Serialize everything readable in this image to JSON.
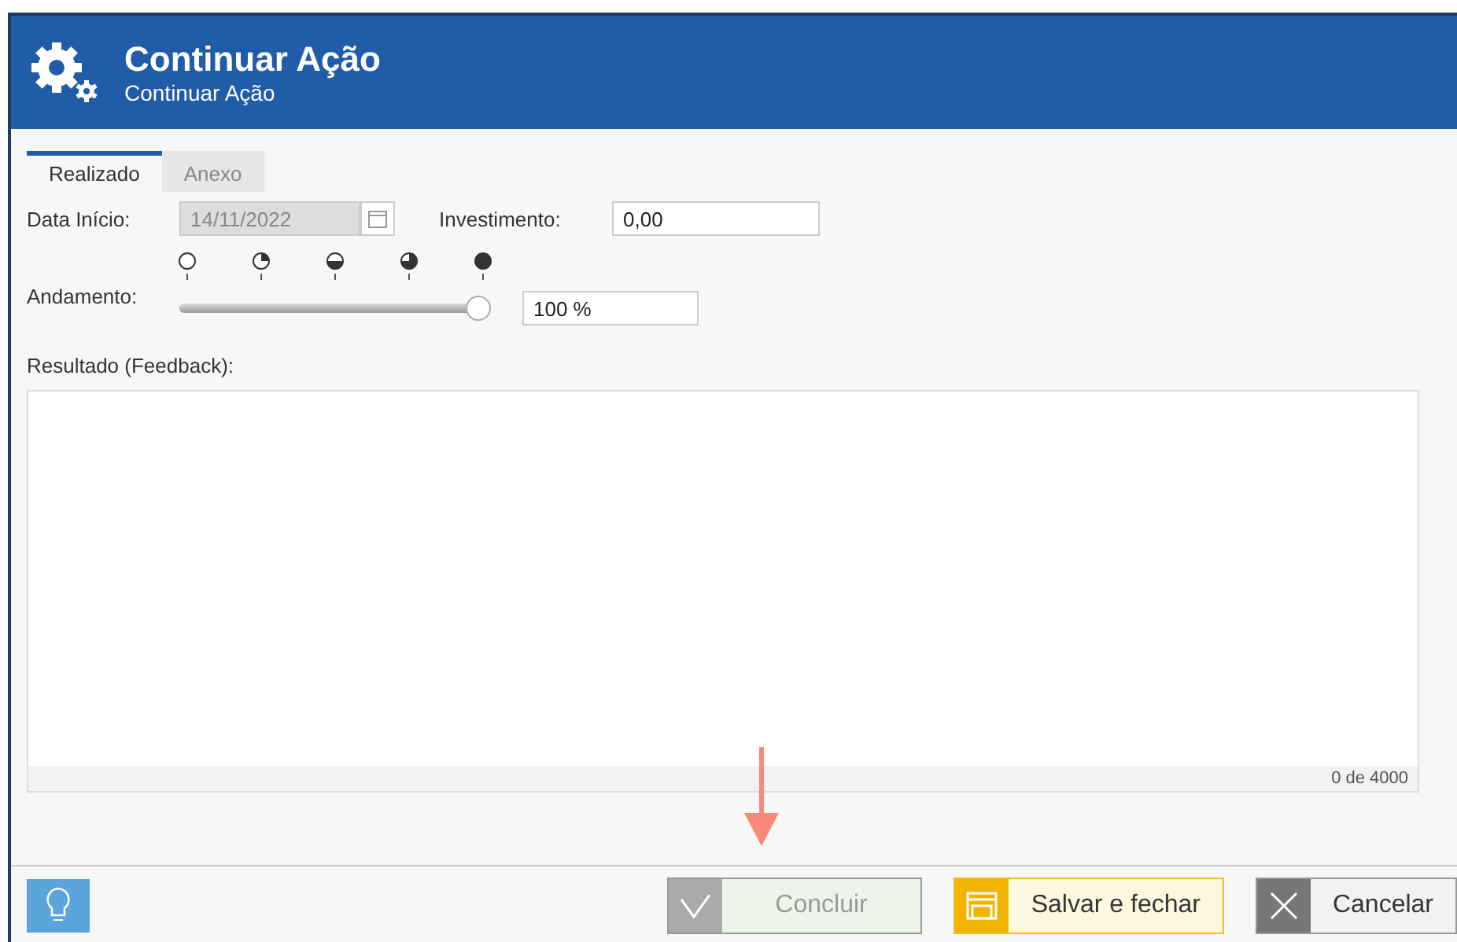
{
  "header": {
    "title": "Continuar Ação",
    "subtitle": "Continuar Ação"
  },
  "tabs": [
    {
      "label": "Realizado",
      "selected": true
    },
    {
      "label": "Anexo",
      "selected": false
    }
  ],
  "start_date": {
    "label": "Data Início:",
    "value": "14/11/2022",
    "disabled": true
  },
  "investment": {
    "label": "Investimento:",
    "value": "0,00"
  },
  "progress": {
    "label": "Andamento:",
    "level": 1,
    "reading": "100 %"
  },
  "feedback": {
    "label": "Resultado (Feedback):",
    "counter": "0 de 4000"
  },
  "buttons": [
    {
      "kind": "confirm",
      "label": "Concluir",
      "disabled": true
    },
    {
      "kind": "save",
      "label": "Salvar e fechar",
      "disabled": false
    },
    {
      "kind": "cancel",
      "label": "Cancelar",
      "disabled": false
    }
  ]
}
